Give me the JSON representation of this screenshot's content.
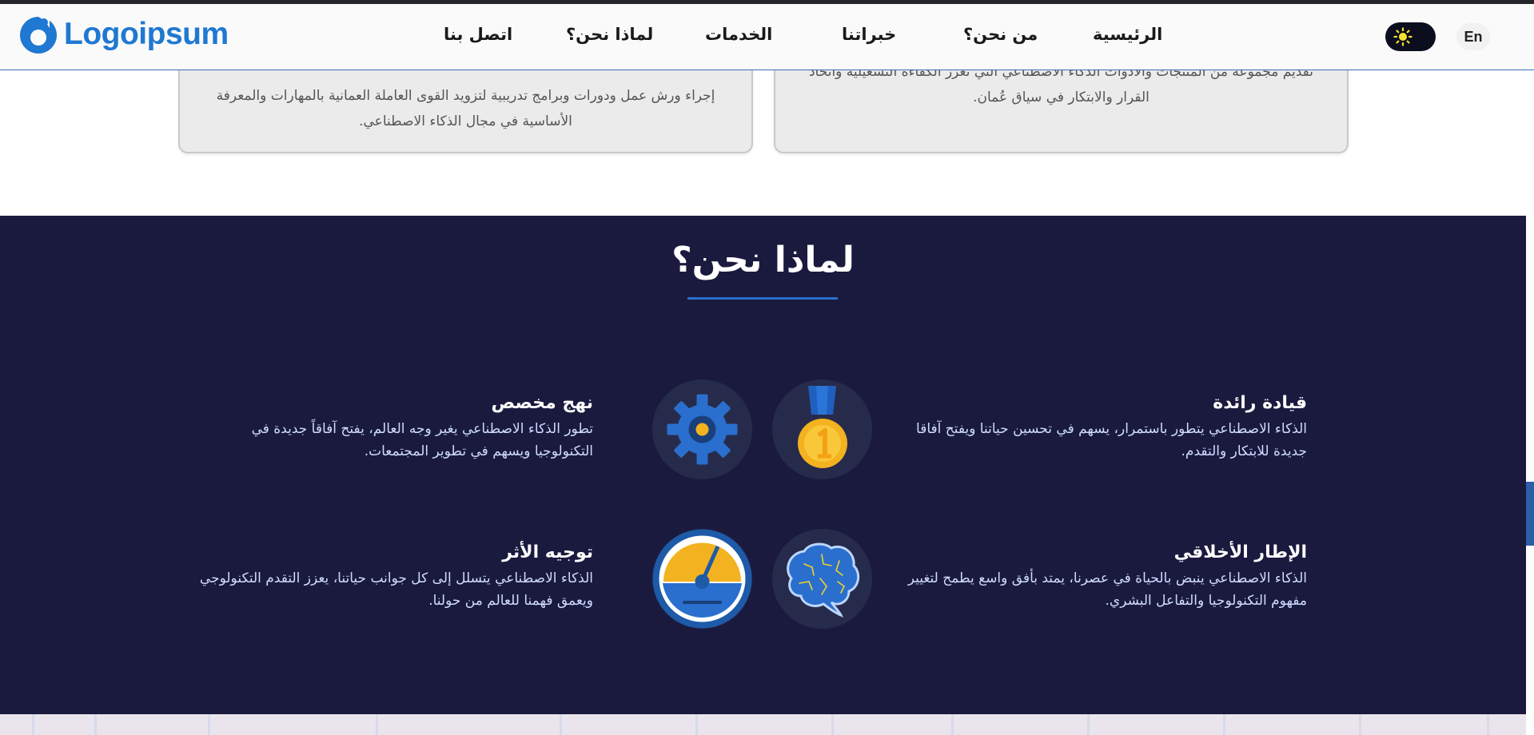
{
  "header": {
    "logo_text": "Logoipsum",
    "nav": [
      "الرئيسية",
      "من نحن؟",
      "خبراتنا",
      "الخدمات",
      "لماذا نحن؟",
      "اتصل بنا"
    ],
    "theme_icon": "sun-icon",
    "lang_label": "En"
  },
  "cards": [
    {
      "text": "تقديم مجموعة من المنتجات والأدوات الذكاء الاصطناعي التي تعزز الكفاءة التشغيلية واتخاذ القرار والابتكار في سياق عُمان."
    },
    {
      "text": "إجراء ورش عمل ودورات وبرامج تدريبية لتزويد القوى العاملة العمانية بالمهارات والمعرفة الأساسية في مجال الذكاء الاصطناعي."
    }
  ],
  "why": {
    "title": "لماذا نحن؟",
    "features": [
      {
        "title": "قيادة رائدة",
        "text": "الذكاء الاصطناعي يتطور باستمرار، يسهم في تحسين حياتنا ويفتح آفاقا جديدة للابتكار والتقدم.",
        "icon": "medal-icon"
      },
      {
        "title": "نهج مخصص",
        "text": "تطور الذكاء الاصطناعي يغير وجه العالم، يفتح آفاقاً جديدة في التكنولوجيا ويسهم في تطوير المجتمعات.",
        "icon": "gear-icon"
      },
      {
        "title": "الإطار الأخلاقي",
        "text": "الذكاء الاصطناعي ينبض بالحياة في عصرنا، يمتد بأفق واسع يطمح لتغيير مفهوم التكنولوجيا والتفاعل البشري.",
        "icon": "brain-icon"
      },
      {
        "title": "توجيه الأثر",
        "text": "الذكاء الاصطناعي يتسلل إلى كل جوانب حياتنا، يعزز التقدم التكنولوجي ويعمق فهمنا للعالم من حولنا.",
        "icon": "gauge-icon"
      }
    ]
  },
  "colors": {
    "brand": "#1f78d1",
    "section_bg": "#1a1a3f",
    "accent_underline": "#2a6fce",
    "medal_gold": "#f3b21f",
    "theme_toggle": "#0c0d1f"
  }
}
